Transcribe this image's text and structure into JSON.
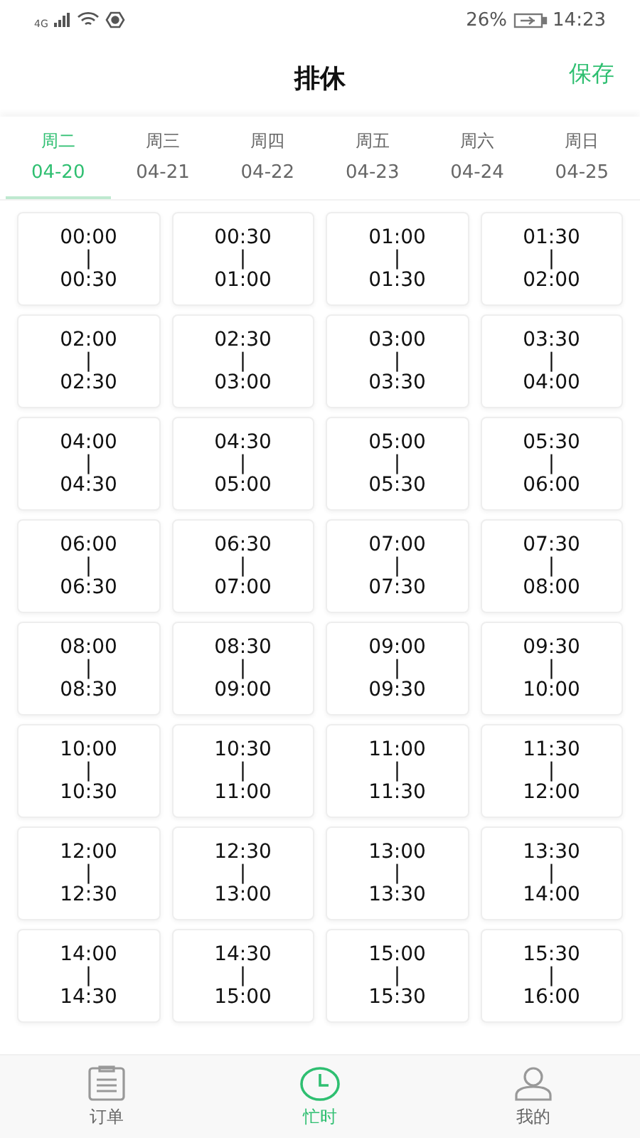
{
  "status_bar": {
    "network": "4G",
    "battery_percent": "26%",
    "time": "14:23"
  },
  "header": {
    "title": "排休",
    "action": "保存"
  },
  "tabs": [
    {
      "weekday": "周二",
      "date": "04-20",
      "selected": true
    },
    {
      "weekday": "周三",
      "date": "04-21",
      "selected": false
    },
    {
      "weekday": "周四",
      "date": "04-22",
      "selected": false
    },
    {
      "weekday": "周五",
      "date": "04-23",
      "selected": false
    },
    {
      "weekday": "周六",
      "date": "04-24",
      "selected": false
    },
    {
      "weekday": "周日",
      "date": "04-25",
      "selected": false
    }
  ],
  "slots": [
    {
      "start": "00:00",
      "sep": "|",
      "end": "00:30"
    },
    {
      "start": "00:30",
      "sep": "|",
      "end": "01:00"
    },
    {
      "start": "01:00",
      "sep": "|",
      "end": "01:30"
    },
    {
      "start": "01:30",
      "sep": "|",
      "end": "02:00"
    },
    {
      "start": "02:00",
      "sep": "|",
      "end": "02:30"
    },
    {
      "start": "02:30",
      "sep": "|",
      "end": "03:00"
    },
    {
      "start": "03:00",
      "sep": "|",
      "end": "03:30"
    },
    {
      "start": "03:30",
      "sep": "|",
      "end": "04:00"
    },
    {
      "start": "04:00",
      "sep": "|",
      "end": "04:30"
    },
    {
      "start": "04:30",
      "sep": "|",
      "end": "05:00"
    },
    {
      "start": "05:00",
      "sep": "|",
      "end": "05:30"
    },
    {
      "start": "05:30",
      "sep": "|",
      "end": "06:00"
    },
    {
      "start": "06:00",
      "sep": "|",
      "end": "06:30"
    },
    {
      "start": "06:30",
      "sep": "|",
      "end": "07:00"
    },
    {
      "start": "07:00",
      "sep": "|",
      "end": "07:30"
    },
    {
      "start": "07:30",
      "sep": "|",
      "end": "08:00"
    },
    {
      "start": "08:00",
      "sep": "|",
      "end": "08:30"
    },
    {
      "start": "08:30",
      "sep": "|",
      "end": "09:00"
    },
    {
      "start": "09:00",
      "sep": "|",
      "end": "09:30"
    },
    {
      "start": "09:30",
      "sep": "|",
      "end": "10:00"
    },
    {
      "start": "10:00",
      "sep": "|",
      "end": "10:30"
    },
    {
      "start": "10:30",
      "sep": "|",
      "end": "11:00"
    },
    {
      "start": "11:00",
      "sep": "|",
      "end": "11:30"
    },
    {
      "start": "11:30",
      "sep": "|",
      "end": "12:00"
    },
    {
      "start": "12:00",
      "sep": "|",
      "end": "12:30"
    },
    {
      "start": "12:30",
      "sep": "|",
      "end": "13:00"
    },
    {
      "start": "13:00",
      "sep": "|",
      "end": "13:30"
    },
    {
      "start": "13:30",
      "sep": "|",
      "end": "14:00"
    },
    {
      "start": "14:00",
      "sep": "|",
      "end": "14:30"
    },
    {
      "start": "14:30",
      "sep": "|",
      "end": "15:00"
    },
    {
      "start": "15:00",
      "sep": "|",
      "end": "15:30"
    },
    {
      "start": "15:30",
      "sep": "|",
      "end": "16:00"
    }
  ],
  "bottom_nav": [
    {
      "kind": "orders",
      "label": "订单",
      "selected": false
    },
    {
      "kind": "clock",
      "label": "忙时",
      "selected": true
    },
    {
      "kind": "profile",
      "label": "我的",
      "selected": false
    }
  ]
}
